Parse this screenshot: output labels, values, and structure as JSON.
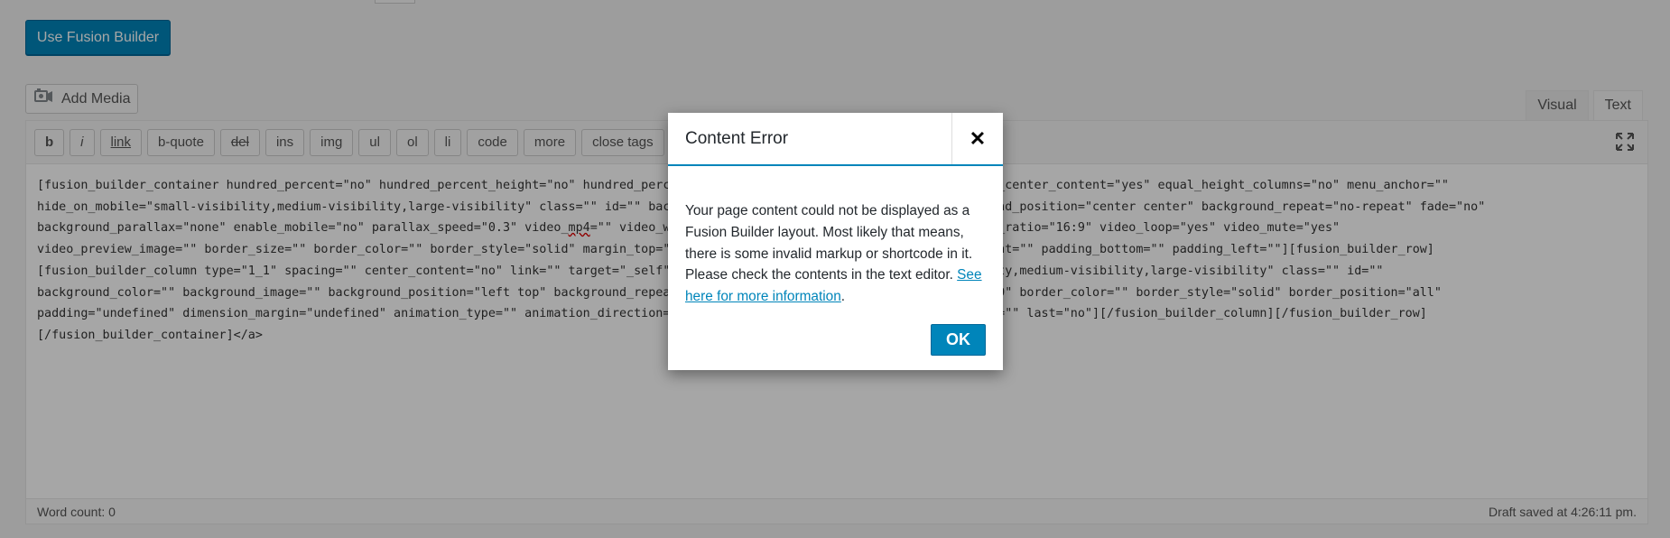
{
  "header": {
    "fusion_button_label": "Use Fusion Builder"
  },
  "media": {
    "add_media_label": "Add Media",
    "icon": "media-camera-icon"
  },
  "mode_tabs": {
    "visual": "Visual",
    "text": "Text"
  },
  "toolbar": {
    "buttons": [
      "b",
      "i",
      "link",
      "b-quote",
      "del",
      "ins",
      "img",
      "ul",
      "ol",
      "li",
      "code",
      "more",
      "close tags"
    ],
    "extra_icon": "fusion-logo-icon",
    "fullscreen_icon": "fullscreen-icon"
  },
  "editor": {
    "lines": [
      "[fusion_builder_container hundred_percent=\"no\" hundred_percent_height=\"no\" hundred_percent_height_scroll=\"no\" hundred_percent_height_center_content=\"yes\" equal_height_columns=\"no\" menu_anchor=\"\"",
      "hide_on_mobile=\"small-visibility,medium-visibility,large-visibility\" class=\"\" id=\"\" background_color=\"\" background_image=\"\" background_position=\"center center\" background_repeat=\"no-repeat\" fade=\"no\"",
      "background_parallax=\"none\" enable_mobile=\"no\" parallax_speed=\"0.3\" video_",
      "mp4",
      "=\"\" video_webm=\"\" video_ogv=\"\" video_url=\"\" video_aspect_ratio=\"16:9\" video_loop=\"yes\" video_mute=\"yes\"",
      "video_preview_image=\"\" border_size=\"\" border_color=\"\" border_style=\"solid\" margin_top=\"\" margin_bottom=\"\" padding_top=\"\" padding_right=\"\" padding_bottom=\"\" padding_left=\"\"][fusion_builder_row]",
      "[fusion_builder_column type=\"1_1\" spacing=\"\" center_content=\"no\" link=\"\" target=\"_self\" min_height=\"\" hide_on_mobile=\"small-visibility,medium-visibility,large-visibility\" class=\"\" id=\"\"",
      "background_color=\"\" background_image=\"\" background_position=\"left top\" background_repeat=\"no-repeat\" hover_type=\"none\" border_size=\"0\" border_color=\"\" border_style=\"solid\" border_position=\"all\"",
      "padding=\"undefined\" dimension_margin=\"undefined\" animation_type=\"\" animation_direction=\"left\" animation_speed=\"0.3\" animation_offset=\"\" last=\"no\"][/fusion_builder_column][/fusion_builder_row]",
      "[/fusion_builder_container]</a>"
    ]
  },
  "status": {
    "word_count": "Word count: 0",
    "draft_saved": "Draft saved at 4:26:11 pm."
  },
  "modal": {
    "title": "Content Error",
    "close_icon": "close-icon",
    "body": "Your page content could not be displayed as a Fusion Builder layout. Most likely that means, there is some invalid markup or shortcode in it. Please check the contents in the text editor.",
    "link_text": "See here for more information",
    "link_suffix": ".",
    "ok_label": "OK"
  }
}
